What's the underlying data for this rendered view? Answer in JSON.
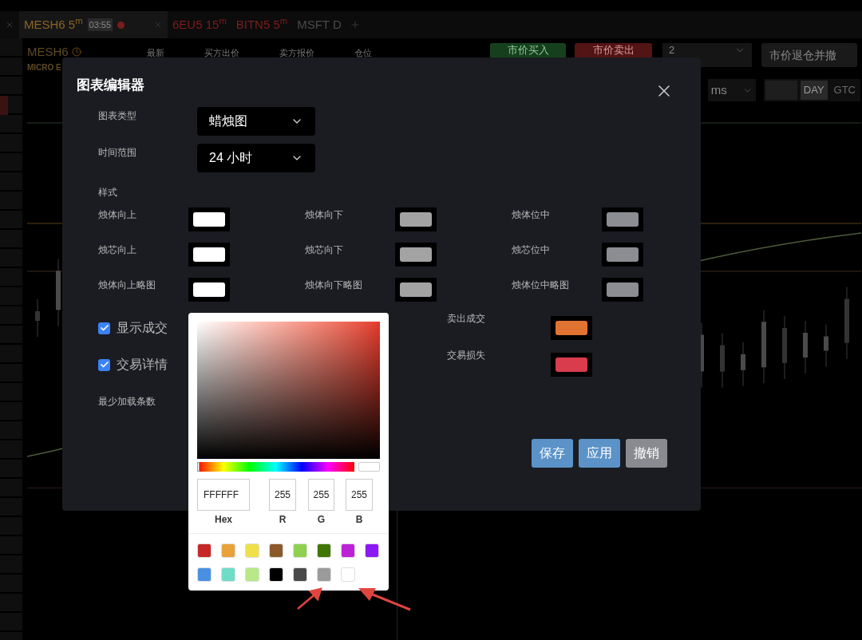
{
  "background_app": {
    "tabs": [
      {
        "label": "MESH6 5$^{m}$",
        "timer": "03:55",
        "selected": true,
        "color": "#8a6424"
      },
      {
        "label": "6EU5 15$^{m}$",
        "selected": false,
        "color": "#7d1d1d"
      },
      {
        "label": "BITN5 5$^{m}$",
        "selected": false,
        "color": "#7d1d1d"
      },
      {
        "label": "MSFT D",
        "selected": false,
        "color": "#4a4a4a"
      }
    ],
    "instrument": {
      "symbol": "MESH6",
      "subtitle": "MICRO E"
    },
    "quote_columns": [
      "最新",
      "买方出价",
      "卖方报价",
      "仓位"
    ],
    "buy_button": "市价买入",
    "sell_button": "市价卖出",
    "quantity": "2",
    "flatten_button": "市价退仓并撤",
    "order_type": "ms",
    "time_in_force": [
      {
        "label": "DAY",
        "selected": true
      },
      {
        "label": "GTC",
        "selected": false
      }
    ]
  },
  "dialog": {
    "title": "图表编辑器",
    "fields": [
      {
        "label": "图表类型",
        "value": "蜡烛图"
      },
      {
        "label": "时间范围",
        "value": "24 小时"
      }
    ],
    "style_heading": "样式",
    "style_colors": [
      {
        "label": "烛体向上",
        "color": "#ffffff"
      },
      {
        "label": "烛体向下",
        "color": "#a3a3a3"
      },
      {
        "label": "烛体位中",
        "color": "#8c8d92"
      },
      {
        "label": "烛芯向上",
        "color": "#ffffff"
      },
      {
        "label": "烛芯向下",
        "color": "#a3a3a3"
      },
      {
        "label": "烛芯位中",
        "color": "#8c8d92"
      },
      {
        "label": "烛体向上略图",
        "color": "#ffffff"
      },
      {
        "label": "烛体向下略图",
        "color": "#a3a3a3"
      },
      {
        "label": "烛体位中略图",
        "color": "#8c8d92"
      }
    ],
    "checkboxes": [
      {
        "label": "显示成交",
        "checked": true
      },
      {
        "label": "交易详情",
        "checked": true
      }
    ],
    "trade_colors": [
      {
        "label": "卖出成交",
        "color": "#e07232"
      },
      {
        "label": "交易损失",
        "color": "#d93c4c"
      }
    ],
    "min_bars_label": "最少加载条数",
    "buttons": [
      {
        "label": "保存",
        "kind": "primary"
      },
      {
        "label": "应用",
        "kind": "primary"
      },
      {
        "label": "撤销",
        "kind": "secondary"
      }
    ]
  },
  "color_picker": {
    "hue_slider": {
      "level": 0
    },
    "hex": "FFFFFF",
    "r": "255",
    "g": "255",
    "b": "255",
    "labels": [
      "Hex",
      "R",
      "G",
      "B"
    ],
    "presets": [
      {
        "color": "#c62828"
      },
      {
        "color": "#e8a23a"
      },
      {
        "color": "#efe04a"
      },
      {
        "color": "#8b5a2b"
      },
      {
        "color": "#8fd14f"
      },
      {
        "color": "#417505"
      },
      {
        "color": "#bd23d6"
      },
      {
        "color": "#8b19f5"
      },
      {
        "color": "#4a90e2"
      },
      {
        "color": "#6fdcc8"
      },
      {
        "color": "#b8e986"
      },
      {
        "color": "#000000"
      },
      {
        "color": "#4a4a4a"
      },
      {
        "color": "#9b9b9b"
      },
      {
        "color": "#ffffff"
      }
    ]
  }
}
